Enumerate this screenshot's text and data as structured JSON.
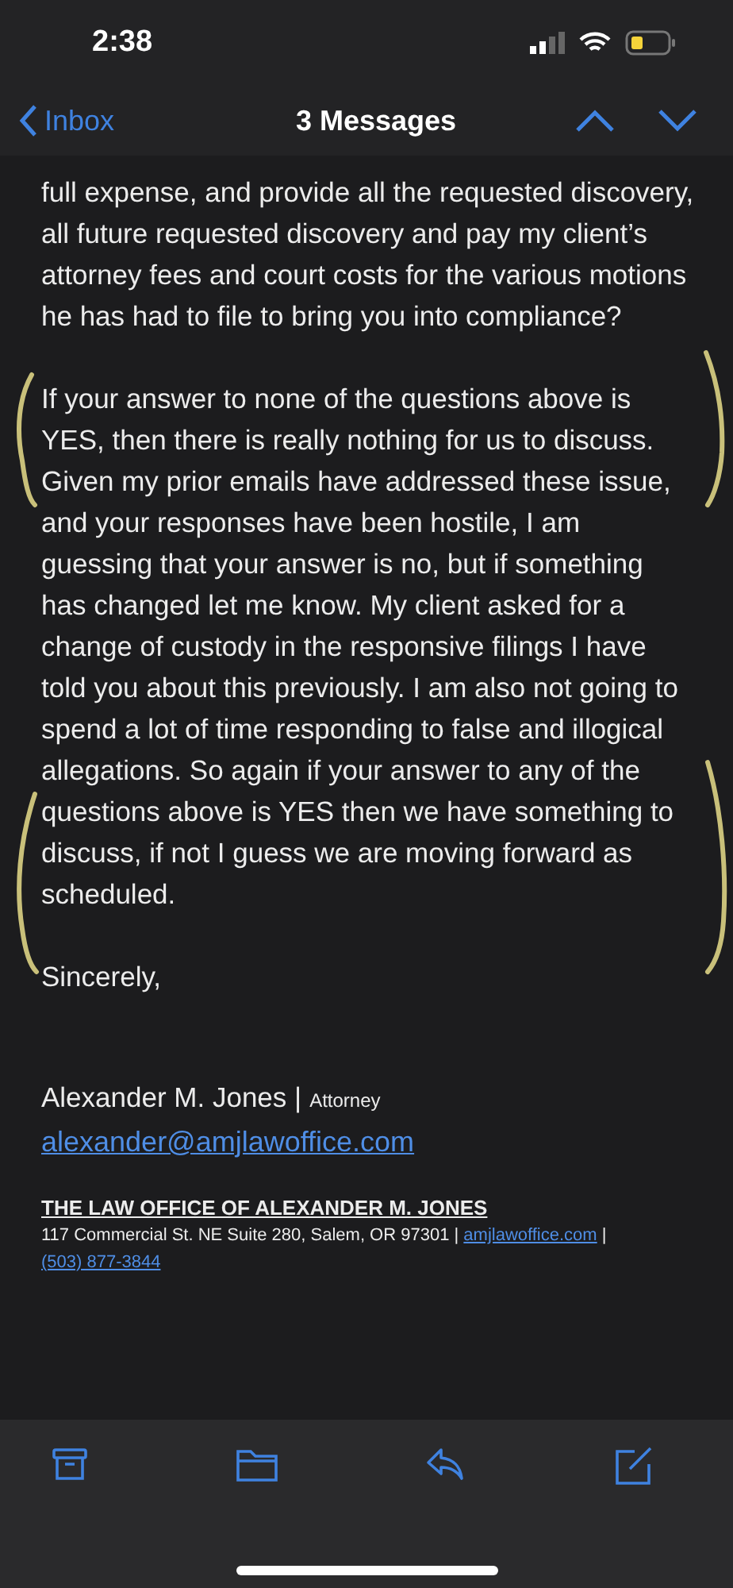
{
  "status_bar": {
    "time": "2:38"
  },
  "nav": {
    "back": "Inbox",
    "title": "3 Messages"
  },
  "message": {
    "paragraphs": [
      "full expense, and provide all the requested discovery, all future requested discovery and pay my client’s attorney fees and court costs for the various motions he has had to file to bring you into compliance?",
      "If your answer to none of the questions above is YES, then there is really nothing for us to discuss. Given my prior emails have addressed these issue, and your responses have been hostile, I am guessing that your answer is no, but if something has changed let me know. My client asked for a change of custody in the responsive filings I have told you about this previously. I am also not going to spend a lot of time responding to false and illogical allegations. So again if your answer to any of the questions above is YES then we have something to discuss, if not I guess we are moving forward as scheduled.",
      "Sincerely,"
    ],
    "signature": {
      "name": "Alexander M. Jones |",
      "role": "Attorney",
      "email": "alexander@amjlawoffice.com",
      "office": "THE LAW OFFICE OF ALEXANDER M. JONES",
      "address": "117 Commercial St. NE Suite 280, Salem, OR 97301 |",
      "website": "amjlawoffice.com",
      "separator": "|",
      "phone": "(503) 877-3844"
    }
  }
}
